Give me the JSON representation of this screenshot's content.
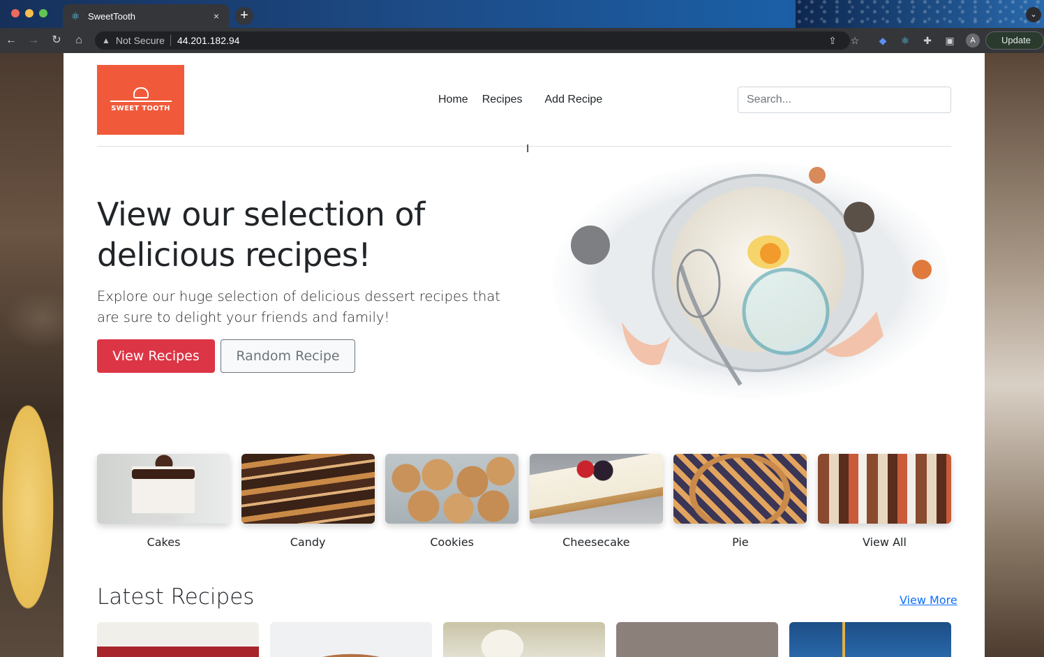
{
  "browser": {
    "tab_title": "SweetTooth",
    "tab_close": "×",
    "new_tab": "+",
    "tab_menu": "⌄",
    "security_label": "Not Secure",
    "url": "44.201.182.94",
    "profile_initial": "A",
    "update_label": "Update",
    "icons": [
      "back-icon",
      "forward-icon",
      "reload-icon",
      "home-icon",
      "share-icon",
      "bookmark-star-icon",
      "extension-icon",
      "puzzle-icon",
      "sidebar-icon"
    ]
  },
  "site": {
    "logo_text": "SWEET TOOTH",
    "nav": [
      "Home",
      "Recipes",
      "Add Recipe"
    ],
    "search_placeholder": "Search...",
    "hero": {
      "title": "View our selection of delicious recipes!",
      "lead": "Explore our huge selection of delicious dessert recipes that are sure to delight your friends and family!",
      "primary_button": "View Recipes",
      "secondary_button": "Random Recipe"
    },
    "categories": [
      "Cakes",
      "Candy",
      "Cookies",
      "Cheesecake",
      "Pie",
      "View All"
    ],
    "latest": {
      "title": "Latest Recipes",
      "view_more": "View More"
    }
  },
  "colors": {
    "brand": "#f05a3a",
    "primary_button": "#dc3545",
    "link": "#0d6efd"
  }
}
